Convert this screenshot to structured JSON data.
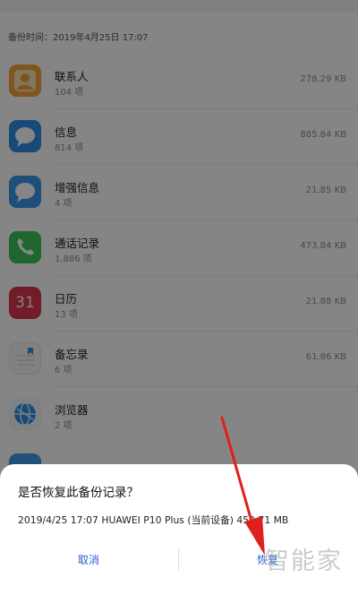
{
  "backup_header": "备份时间：2019年4月25日 17:07",
  "apps": [
    {
      "name": "联系人",
      "count": "104 项",
      "size": "278.29 KB",
      "icon": "contacts-icon"
    },
    {
      "name": "信息",
      "count": "814 项",
      "size": "885.84 KB",
      "icon": "messages-icon"
    },
    {
      "name": "增强信息",
      "count": "4 项",
      "size": "21.85 KB",
      "icon": "enhanced-messages-icon"
    },
    {
      "name": "通话记录",
      "count": "1,886 项",
      "size": "473.84 KB",
      "icon": "phone-icon"
    },
    {
      "name": "日历",
      "count": "13 项",
      "size": "21.88 KB",
      "icon": "calendar-icon",
      "icon_text": "31"
    },
    {
      "name": "备忘录",
      "count": "6 项",
      "size": "61.86 KB",
      "icon": "notepad-icon"
    },
    {
      "name": "浏览器",
      "count": "2 项",
      "size": "",
      "icon": "browser-icon"
    }
  ],
  "dialog": {
    "title": "是否恢复此备份记录？",
    "detail": "2019/4/25 17:07  HUAWEI P10 Plus (当前设备)  452.71 MB",
    "cancel_label": "取消",
    "restore_label": "恢复"
  },
  "watermark": "智能家",
  "colors": {
    "accent": "#2a5fd6",
    "arrow": "#e0201a",
    "contacts": "#f2a53b",
    "messages": "#2f8ee6",
    "phone": "#3cc35a",
    "calendar": "#d8364a"
  }
}
